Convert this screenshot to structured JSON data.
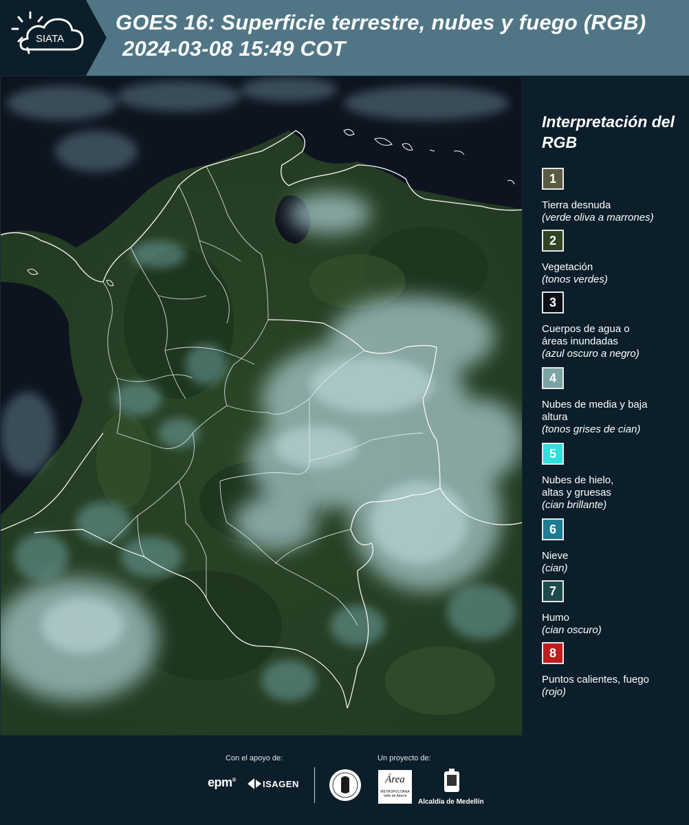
{
  "header": {
    "title_line1": "GOES 16: Superficie terrestre, nubes y fuego (RGB)",
    "title_line2": "2024-03-08 15:49 COT",
    "logo_text": "SIATA",
    "background": "#507686"
  },
  "legend": {
    "title": "Interpretación del RGB",
    "items": [
      {
        "number": "1",
        "label": "Tierra desnuda",
        "desc": "(verde oliva a marrones)",
        "color": "#5b5a43"
      },
      {
        "number": "2",
        "label": "Vegetación",
        "desc": "(tonos verdes)",
        "color": "#2f4422"
      },
      {
        "number": "3",
        "label": "Cuerpos de agua o áreas inundadas",
        "desc": "(azul oscuro a negro)",
        "color": "#0b0e16"
      },
      {
        "number": "4",
        "label": "Nubes de media y baja altura",
        "desc": "(tonos grises de cian)",
        "color": "#7aa3a4"
      },
      {
        "number": "5",
        "label": "Nubes de hielo, altas y gruesas",
        "desc": "(cian brillante)",
        "color": "#2ee0de"
      },
      {
        "number": "6",
        "label": "Nieve",
        "desc": "(cian)",
        "color": "#1d7d92"
      },
      {
        "number": "7",
        "label": "Humo",
        "desc": "(cian oscuro)",
        "color": "#1d4a4c"
      },
      {
        "number": "8",
        "label": "Puntos calientes, fuego",
        "desc": "(rojo)",
        "color": "#c01e1e"
      }
    ]
  },
  "footer": {
    "support_label": "Con el apoyo de:",
    "project_label": "Un proyecto de:",
    "epm": "epm",
    "isagen": "ISAGEN",
    "area_metropolitana": "METROPOLITANA",
    "area_sub": "Valle de Aburrá",
    "area_word": "Área",
    "alcaldia": "Alcaldía de Medellín"
  },
  "map": {
    "kind": "satellite RGB composite",
    "icons": [
      "colombia-outline",
      "department-borders",
      "cloud-fields"
    ]
  }
}
